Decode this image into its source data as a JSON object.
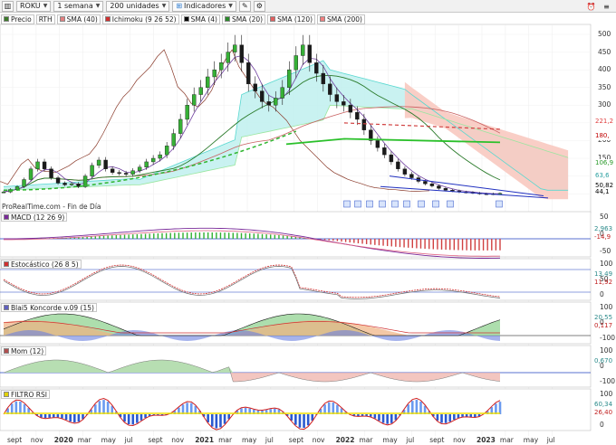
{
  "toolbar": {
    "symbol": "ROKU",
    "period": "1 semana",
    "units": "200 unidades",
    "indicators": "Indicadores"
  },
  "main_legend": [
    {
      "label": "Precio",
      "color": "#3b7a2a"
    },
    {
      "label": "RTH",
      "color": ""
    },
    {
      "label": "SMA (40)",
      "color": "#e28080"
    },
    {
      "label": "Ichimoku (9 26 52)",
      "color": "#d03030"
    },
    {
      "label": "SMA (4)",
      "color": "#000000"
    },
    {
      "label": "SMA (20)",
      "color": "#2a8a2a"
    },
    {
      "label": "SMA (120)",
      "color": "#e06060"
    },
    {
      "label": "SMA (200)",
      "color": "#f08080"
    }
  ],
  "source_text": "ProRealTime.com - Fin de Día",
  "price_axis": [
    "500",
    "450",
    "400",
    "350",
    "300",
    "250",
    "200",
    "150",
    "100",
    "50"
  ],
  "price_tags": [
    {
      "label": "221,2",
      "color": "#e04040",
      "bg": "#ffffff"
    },
    {
      "label": "180,",
      "color": "#c00000",
      "bg": "#ffffff"
    },
    {
      "label": "106,9",
      "color": "#2a9a2a",
      "bg": "#ffffff"
    },
    {
      "label": "63,6",
      "color": "#2aa0a0",
      "bg": "#ffffff"
    },
    {
      "label": "50,82",
      "color": "#000000",
      "bg": "#ffffff"
    },
    {
      "label": "44,1",
      "color": "#000000",
      "bg": "#ffffff"
    }
  ],
  "panels": [
    {
      "label": "MACD (12 26 9)",
      "color": "#7a2a9a",
      "ticks": [
        "50",
        "0",
        "-50"
      ],
      "tags": [
        "2,963",
        "-14,9"
      ]
    },
    {
      "label": "Estocástico (26 8 5)",
      "color": "#d03030",
      "ticks": [
        "100",
        "50",
        "0"
      ],
      "tags": [
        "13,49",
        "11,92"
      ]
    },
    {
      "label": "Blai5 Koncorde v.09 (15)",
      "color": "#6060c0",
      "ticks": [
        "100",
        "0",
        "-100"
      ],
      "tags": [
        "20,55",
        "0,117"
      ]
    },
    {
      "label": "Mom (12)",
      "color": "#b05050",
      "ticks": [
        "100",
        "0",
        "-100"
      ],
      "tags": [
        "0,670"
      ]
    },
    {
      "label": "FILTRO RSI",
      "color": "#e0d000",
      "ticks": [
        "100",
        "0"
      ],
      "tags": [
        "60,34",
        "26,40"
      ]
    }
  ],
  "time_axis": [
    "sept",
    "nov",
    "2020",
    "mar",
    "may",
    "jul",
    "sept",
    "nov",
    "2021",
    "mar",
    "may",
    "jul",
    "sept",
    "nov",
    "2022",
    "mar",
    "may",
    "jul",
    "sept",
    "nov",
    "2023",
    "mar",
    "may",
    "jul"
  ]
}
